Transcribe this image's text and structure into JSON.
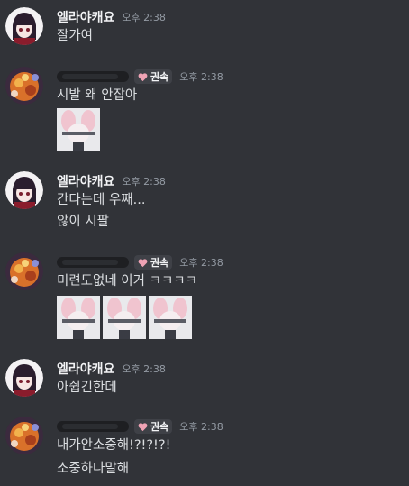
{
  "messages": [
    {
      "username": "엘라야캐요",
      "timestamp": "오후 2:38",
      "lines": [
        "잘가여"
      ]
    },
    {
      "username": "",
      "role": "권속",
      "timestamp": "오후 2:38",
      "lines": [
        "시발 왜 안잡아"
      ],
      "sticker_count": 1
    },
    {
      "username": "엘라야캐요",
      "timestamp": "오후 2:38",
      "lines": [
        "간다는데 우째...",
        "않이 시팔"
      ]
    },
    {
      "username": "",
      "role": "권속",
      "timestamp": "오후 2:38",
      "lines": [
        "미련도없네 이거 ㅋㅋㅋㅋ"
      ],
      "sticker_count": 3
    },
    {
      "username": "엘라야캐요",
      "timestamp": "오후 2:38",
      "lines": [
        "아쉽긴한데"
      ]
    },
    {
      "username": "",
      "role": "권속",
      "timestamp": "오후 2:38",
      "lines": [
        "내가안소중해!?!?!?!",
        "소중하다말해"
      ]
    }
  ],
  "icons": {
    "avatar_a": "anime-girl-avatar",
    "avatar_b": "orange-character-avatar",
    "role_icon": "heart-icon",
    "sticker": "anime-character-sticker"
  },
  "colors": {
    "background": "#313338",
    "username": "#f2f3f5",
    "message_text": "#dbdee1",
    "timestamp": "#949ba4",
    "role_badge_bg": "#3f4147",
    "heart": "#f0a3b5"
  }
}
